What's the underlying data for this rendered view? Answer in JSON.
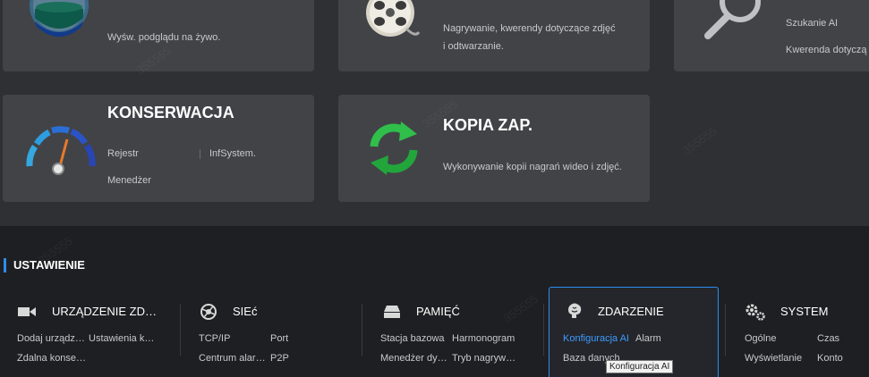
{
  "cards": {
    "live": {
      "desc": "Wyśw. podglądu na żywo."
    },
    "playback": {
      "desc_line1": "Nagrywanie, kwerendy dotyczące zdjęć",
      "desc_line2": "i odtwarzanie."
    },
    "ai": {
      "link1": "Szukanie AI",
      "link2": "Kwerenda dotyczą"
    },
    "maintenance": {
      "title": "KONSERWACJA",
      "link1": "Rejestr",
      "link2": "InfSystem.",
      "link3": "Menedżer"
    },
    "backup": {
      "title": "KOPIA ZAP.",
      "desc": "Wykonywanie kopii nagrań wideo i zdjęć."
    }
  },
  "settings": {
    "title": "USTAWIENIE",
    "columns": [
      {
        "label": "URZĄDZENIE ZD…",
        "icon": "camera-icon",
        "items": [
          "Dodaj urządz…",
          "Ustawienia k…",
          "Zdalna konse…"
        ]
      },
      {
        "label": "SIEć",
        "icon": "network-icon",
        "items": [
          "TCP/IP",
          "Port",
          "Centrum alar…",
          "P2P"
        ]
      },
      {
        "label": "PAMIĘĆ",
        "icon": "storage-icon",
        "items": [
          "Stacja bazowa",
          "Harmonogram",
          "Menedżer dy…",
          "Tryb nagryw…"
        ]
      },
      {
        "label": "ZDARZENIE",
        "icon": "brain-icon",
        "items": [
          "Konfiguracja AI",
          "Alarm",
          "Baza danych"
        ]
      },
      {
        "label": "SYSTEM",
        "icon": "gears-icon",
        "items": [
          "Ogólne",
          "Czas",
          "Wyświetlanie",
          "Konto"
        ]
      }
    ]
  },
  "tooltip": "Konfiguracja AI",
  "watermark": "355555"
}
